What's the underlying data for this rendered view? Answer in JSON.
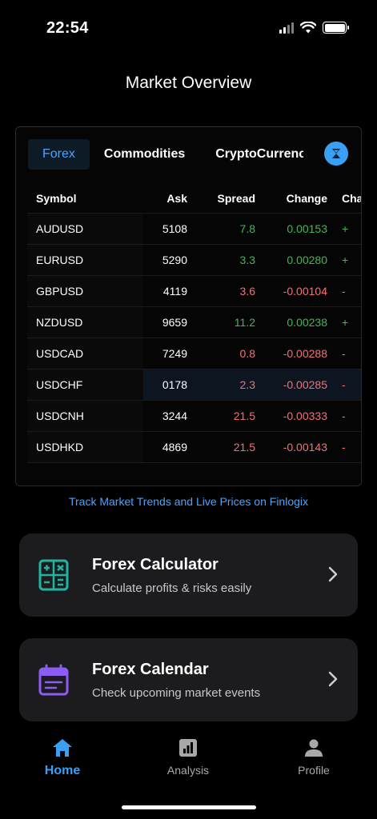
{
  "status": {
    "time": "22:54"
  },
  "header": {
    "title": "Market Overview"
  },
  "market": {
    "tabs": [
      {
        "label": "Forex",
        "active": true
      },
      {
        "label": "Commodities",
        "active": false
      },
      {
        "label": "CryptoCurrenc",
        "active": false
      }
    ],
    "brand_badge": "X",
    "columns": {
      "symbol": "Symbol",
      "ask": "Ask",
      "spread": "Spread",
      "change": "Change",
      "chg_pct": "Cha"
    },
    "rows": [
      {
        "symbol": "AUDUSD",
        "ask": "5108",
        "spread": "7.8",
        "change": "0.00153",
        "chg_pct": "+",
        "trend": "up"
      },
      {
        "symbol": "EURUSD",
        "ask": "5290",
        "spread": "3.3",
        "change": "0.00280",
        "chg_pct": "+",
        "trend": "up"
      },
      {
        "symbol": "GBPUSD",
        "ask": "4119",
        "spread": "3.6",
        "change": "-0.00104",
        "chg_pct": "-",
        "trend": "down"
      },
      {
        "symbol": "NZDUSD",
        "ask": "9659",
        "spread": "11.2",
        "change": "0.00238",
        "chg_pct": "+",
        "trend": "up"
      },
      {
        "symbol": "USDCAD",
        "ask": "7249",
        "spread": "0.8",
        "change": "-0.00288",
        "chg_pct": "-",
        "trend": "down"
      },
      {
        "symbol": "USDCHF",
        "ask": "0178",
        "spread": "2.3",
        "change": "-0.00285",
        "chg_pct": "-",
        "trend": "down"
      },
      {
        "symbol": "USDCNH",
        "ask": "3244",
        "spread": "21.5",
        "change": "-0.00333",
        "chg_pct": "-",
        "trend": "down"
      },
      {
        "symbol": "USDHKD",
        "ask": "4869",
        "spread": "21.5",
        "change": "-0.00143",
        "chg_pct": "-",
        "trend": "down"
      }
    ]
  },
  "promo": {
    "text": "Track Market Trends and Live Prices on Finlogix"
  },
  "cards": {
    "calculator": {
      "title": "Forex Calculator",
      "subtitle": "Calculate profits & risks easily",
      "icon": "calculator-icon"
    },
    "calendar": {
      "title": "Forex Calendar",
      "subtitle": "Check upcoming market events",
      "icon": "calendar-icon"
    }
  },
  "nav": {
    "home": "Home",
    "analysis": "Analysis",
    "profile": "Profile"
  },
  "colors": {
    "accent": "#3aa0f5",
    "positive": "#3fb950",
    "negative": "#f07178",
    "calc_icon": "#1fb5a0",
    "calendar_icon": "#8b5cf6"
  }
}
